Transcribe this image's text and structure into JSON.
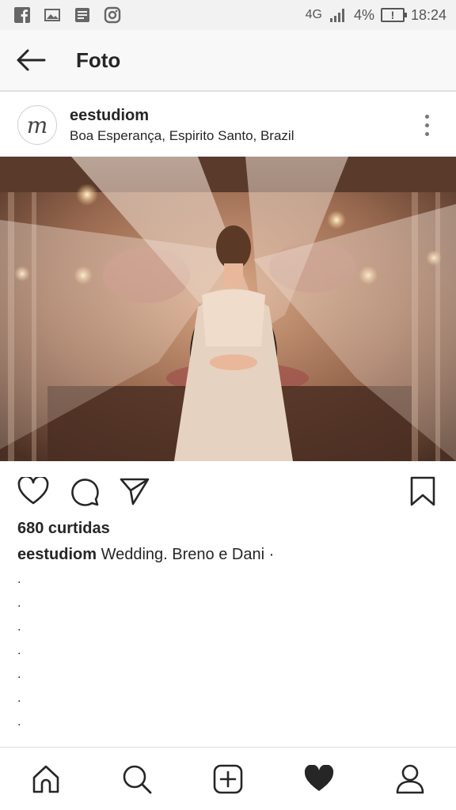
{
  "status_bar": {
    "network": "4G",
    "battery": "4%",
    "time": "18:24",
    "icons": [
      "facebook-icon",
      "image-icon",
      "book-icon",
      "instagram-icon",
      "signal-icon",
      "battery-icon"
    ]
  },
  "app_bar": {
    "title": "Foto",
    "back_icon": "arrow-left-icon"
  },
  "post": {
    "avatar_letter": "m",
    "username": "eestudiom",
    "location": "Boa Esperança, Espirito Santo, Brazil",
    "more_icon": "more-vertical-icon",
    "likes": "680 curtidas",
    "caption_user": "eestudiom",
    "caption_text": " Wedding. Breno e Dani ·",
    "caption_dots": [
      ".",
      ".",
      ".",
      ".",
      ".",
      ".",
      ".",
      "."
    ]
  },
  "actions": {
    "like_icon": "heart-icon",
    "comment_icon": "comment-icon",
    "share_icon": "send-icon",
    "save_icon": "bookmark-icon"
  },
  "bottom_nav": {
    "items": [
      "home-icon",
      "search-icon",
      "add-icon",
      "activity-heart-icon",
      "profile-icon"
    ]
  },
  "colors": {
    "text": "#262626",
    "status_bg": "#f2f2f2",
    "divider": "#dbdbdb"
  }
}
